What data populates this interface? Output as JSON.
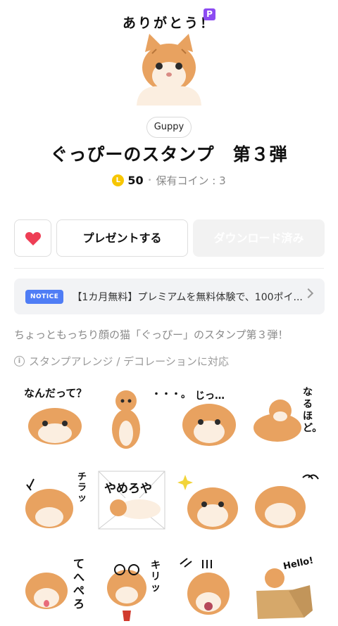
{
  "hero": {
    "caption": "ありがとう！",
    "premium_badge": "P"
  },
  "author": "Guppy",
  "title": "ぐっぴーのスタンプ　第３弾",
  "price": {
    "coin_icon": "L",
    "amount": "50",
    "separator": "•",
    "owned_label": "保有コイン : 3"
  },
  "actions": {
    "like_icon": "heart-icon",
    "present_label": "プレゼントする",
    "download_label": "ダウンロード済み"
  },
  "notice": {
    "badge": "NOTICE",
    "text": "【1カ月無料】プレミアムを無料体験で、100ポイ..."
  },
  "description": "ちょっともっちり顔の猫「ぐっぴー」のスタンプ第３弾！",
  "feature": {
    "icon": "i",
    "text": "スタンプアレンジ / デコレーションに対応"
  },
  "stamps": [
    {
      "text": "なんだって？"
    },
    {
      "text": "・・・。"
    },
    {
      "text": "じっ…"
    },
    {
      "text": "なるほど。"
    },
    {
      "text": "チラッ"
    },
    {
      "text": "やめろや"
    },
    {
      "text": ""
    },
    {
      "text": ""
    },
    {
      "text": "てへぺろ"
    },
    {
      "text": "キリッ"
    },
    {
      "text": ""
    },
    {
      "text": "Hello!"
    }
  ],
  "colors": {
    "cat_orange": "#e8a260",
    "cat_cream": "#fbeee0",
    "heart": "#ee3e55",
    "notice_badge": "#4f7df5",
    "premium": "#8c4bf2",
    "coin": "#f7c600"
  }
}
